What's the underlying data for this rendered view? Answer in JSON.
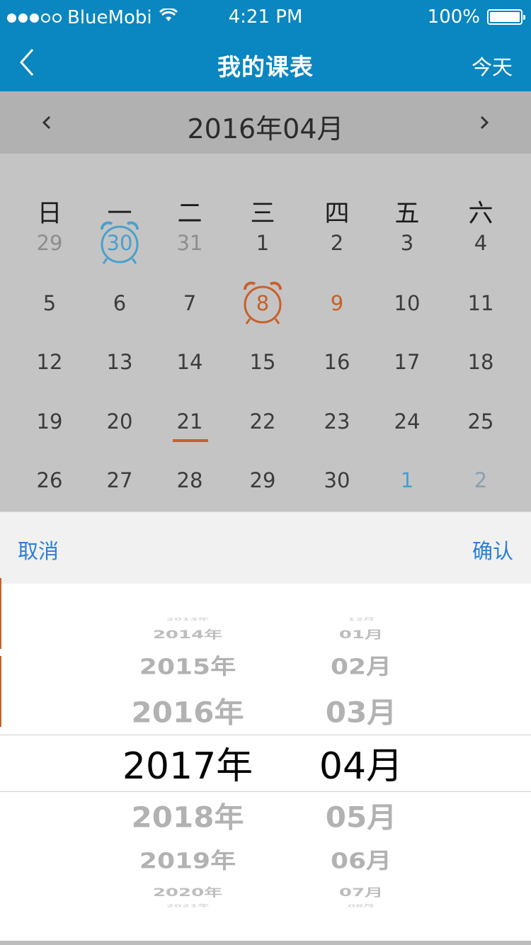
{
  "status": {
    "carrier": "BlueMobi",
    "time": "4:21 PM",
    "battery": "100%",
    "signal_bars": 5,
    "signal_filled": 3
  },
  "nav": {
    "title": "我的课表",
    "right": "今天",
    "back_icon": "chevron-left-icon"
  },
  "month": {
    "label": "2016年04月",
    "prev_icon": "chevron-left-icon",
    "next_icon": "chevron-right-icon"
  },
  "calendar": {
    "weekdays": [
      "日",
      "一",
      "二",
      "三",
      "四",
      "五",
      "六"
    ],
    "rows": [
      [
        {
          "d": "29",
          "s": "muted"
        },
        {
          "d": "30",
          "s": "blue",
          "alarm": "blue"
        },
        {
          "d": "31",
          "s": "muted"
        },
        {
          "d": "1"
        },
        {
          "d": "2"
        },
        {
          "d": "3"
        },
        {
          "d": "4"
        }
      ],
      [
        {
          "d": "5"
        },
        {
          "d": "6"
        },
        {
          "d": "7"
        },
        {
          "d": "8",
          "s": "orange",
          "alarm": "orange"
        },
        {
          "d": "9",
          "s": "orange"
        },
        {
          "d": "10"
        },
        {
          "d": "11"
        }
      ],
      [
        {
          "d": "12"
        },
        {
          "d": "13"
        },
        {
          "d": "14"
        },
        {
          "d": "15"
        },
        {
          "d": "16"
        },
        {
          "d": "17"
        },
        {
          "d": "18"
        }
      ],
      [
        {
          "d": "19"
        },
        {
          "d": "20"
        },
        {
          "d": "21",
          "today": true
        },
        {
          "d": "22"
        },
        {
          "d": "23"
        },
        {
          "d": "24"
        },
        {
          "d": "25"
        }
      ],
      [
        {
          "d": "26"
        },
        {
          "d": "27"
        },
        {
          "d": "28"
        },
        {
          "d": "29"
        },
        {
          "d": "30"
        },
        {
          "d": "1",
          "s": "blue"
        },
        {
          "d": "2",
          "s": "blue-faint"
        }
      ]
    ],
    "colors": {
      "accent_orange": "#c8602b",
      "accent_blue": "#4aa0cc"
    }
  },
  "picker": {
    "cancel": "取消",
    "confirm": "确认",
    "years": [
      "2013年",
      "2014年",
      "2015年",
      "2016年",
      "2017年",
      "2018年",
      "2019年",
      "2020年",
      "2021年"
    ],
    "months": [
      "12月",
      "01月",
      "02月",
      "03月",
      "04月",
      "05月",
      "06月",
      "07月",
      "08月"
    ],
    "selected_year": "2017年",
    "selected_month": "04月"
  }
}
